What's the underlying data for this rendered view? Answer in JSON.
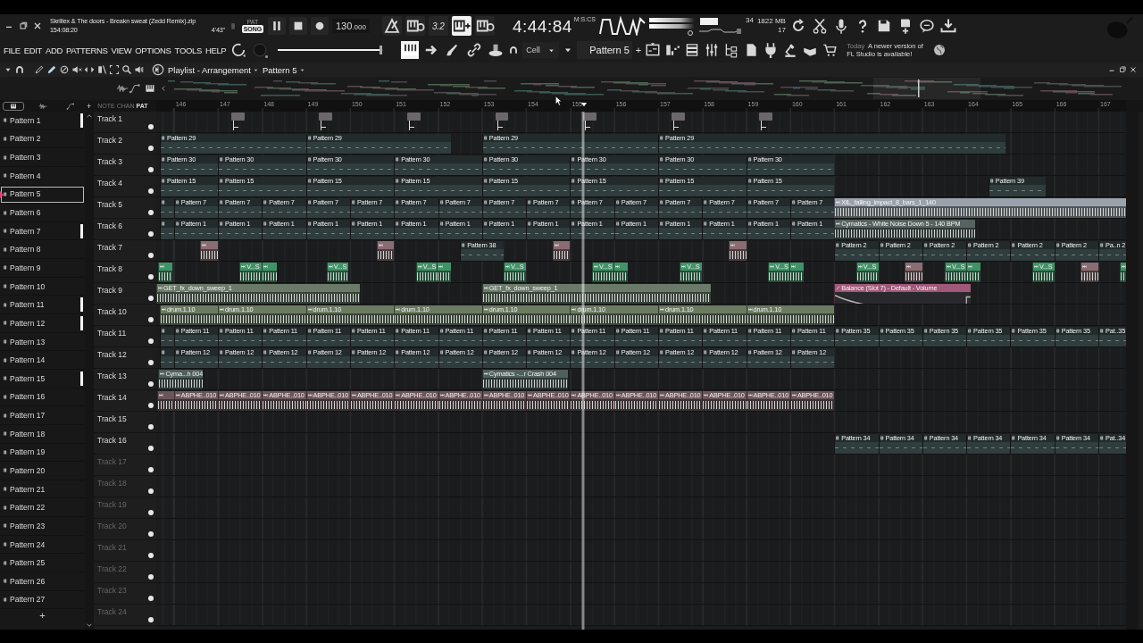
{
  "title_bar": {
    "song": "Skrillex & The doors - Breakn sweat (Zedd Remix).zip",
    "position": "154:08:20",
    "length": "4'43\""
  },
  "transport": {
    "modes": [
      {
        "label": "PAT",
        "selected": false
      },
      {
        "label": "SONG",
        "selected": true
      }
    ],
    "tempo": "130",
    "tempo_fraction": ".000",
    "toggles": [
      {
        "on": false
      },
      {
        "on": false
      },
      {
        "label": "3.2",
        "on": false
      },
      {
        "on": true
      },
      {
        "on": false
      }
    ],
    "time": "4:44:84",
    "time_unit": "M:S:CS"
  },
  "monitor": {
    "cpu": "34",
    "memory": "1822 MB",
    "polyphony": "17"
  },
  "menu": [
    "FILE",
    "EDIT",
    "ADD",
    "PATTERNS",
    "VIEW",
    "OPTIONS",
    "TOOLS",
    "HELP"
  ],
  "master_volume": {
    "level": 0.97
  },
  "toolbar": {
    "snap": "Cell",
    "pattern": "Pattern 5",
    "add": "+",
    "notice_time": "Today",
    "notice": "A newer version of FL Studio is available!"
  },
  "playlist": {
    "title": "Playlist - Arrangement",
    "pattern": "Pattern 5",
    "add": "+",
    "picker_tabs": [
      {
        "label": "NOTE",
        "selected": false
      },
      {
        "label": "CHAN",
        "selected": false
      },
      {
        "label": "PAT",
        "selected": true
      }
    ],
    "ruler": [
      "146",
      "147",
      "148",
      "149",
      "150",
      "151",
      "152",
      "153",
      "154",
      "155",
      "156",
      "157",
      "158",
      "159",
      "160",
      "161",
      "162",
      "163",
      "164",
      "165",
      "166",
      "167"
    ],
    "patterns": [
      {
        "name": "Pattern 1",
        "selected": false,
        "marked": true
      },
      {
        "name": "Pattern 2",
        "selected": false,
        "marked": false
      },
      {
        "name": "Pattern 3",
        "selected": false,
        "marked": false
      },
      {
        "name": "Pattern 4",
        "selected": false,
        "marked": false
      },
      {
        "name": "Pattern 5",
        "selected": true,
        "marked": false
      },
      {
        "name": "Pattern 6",
        "selected": false,
        "marked": false
      },
      {
        "name": "Pattern 7",
        "selected": false,
        "marked": true
      },
      {
        "name": "Pattern 8",
        "selected": false,
        "marked": false
      },
      {
        "name": "Pattern 9",
        "selected": false,
        "marked": false
      },
      {
        "name": "Pattern 10",
        "selected": false,
        "marked": false
      },
      {
        "name": "Pattern 11",
        "selected": false,
        "marked": true
      },
      {
        "name": "Pattern 12",
        "selected": false,
        "marked": true
      },
      {
        "name": "Pattern 13",
        "selected": false,
        "marked": false
      },
      {
        "name": "Pattern 14",
        "selected": false,
        "marked": false
      },
      {
        "name": "Pattern 15",
        "selected": false,
        "marked": true
      },
      {
        "name": "Pattern 16",
        "selected": false,
        "marked": false
      },
      {
        "name": "Pattern 17",
        "selected": false,
        "marked": false
      },
      {
        "name": "Pattern 18",
        "selected": false,
        "marked": false
      },
      {
        "name": "Pattern 19",
        "selected": false,
        "marked": false
      },
      {
        "name": "Pattern 20",
        "selected": false,
        "marked": false
      },
      {
        "name": "Pattern 21",
        "selected": false,
        "marked": false
      },
      {
        "name": "Pattern 22",
        "selected": false,
        "marked": false
      },
      {
        "name": "Pattern 23",
        "selected": false,
        "marked": false
      },
      {
        "name": "Pattern 24",
        "selected": false,
        "marked": false
      },
      {
        "name": "Pattern 25",
        "selected": false,
        "marked": false
      },
      {
        "name": "Pattern 26",
        "selected": false,
        "marked": false
      },
      {
        "name": "Pattern 27",
        "selected": false,
        "marked": false
      }
    ],
    "tracks": [
      {
        "name": "Track 1",
        "dim": false,
        "clips": [
          {
            "kind": "marker",
            "color": "#6c676b"
          },
          {
            "kind": "marker",
            "color": "#6c676b"
          },
          {
            "kind": "marker",
            "color": "#6c676b"
          },
          {
            "kind": "marker",
            "color": "#6c676b"
          },
          {
            "kind": "marker",
            "color": "#6c676b"
          },
          {
            "kind": "marker",
            "color": "#6c676b"
          },
          {
            "kind": "marker",
            "color": "#6c676b"
          }
        ]
      },
      {
        "name": "Track 2",
        "dim": false,
        "clips": [
          {
            "kind": "pattern",
            "label": "Pattern 29"
          },
          {
            "kind": "pattern",
            "label": "Pattern 29"
          },
          {
            "kind": "pattern",
            "label": "Pattern 29"
          },
          {
            "kind": "pattern",
            "label": "Pattern 29"
          }
        ]
      },
      {
        "name": "Track 3",
        "dim": false,
        "clips": [
          {
            "kind": "pattern",
            "label": "Pattern 30"
          },
          {
            "kind": "pattern",
            "label": "Pattern 30"
          },
          {
            "kind": "pattern",
            "label": "Pattern 30"
          },
          {
            "kind": "pattern",
            "label": "Pattern 30"
          },
          {
            "kind": "pattern",
            "label": "Pattern 30"
          },
          {
            "kind": "pattern",
            "label": "Pattern 30"
          },
          {
            "kind": "pattern",
            "label": "Pattern 30"
          },
          {
            "kind": "pattern",
            "label": "Pattern 30"
          }
        ]
      },
      {
        "name": "Track 4",
        "dim": false,
        "clips": [
          {
            "kind": "pattern",
            "label": "Pattern 15"
          },
          {
            "kind": "pattern",
            "label": "Pattern 15"
          },
          {
            "kind": "pattern",
            "label": "Pattern 15"
          },
          {
            "kind": "pattern",
            "label": "Pattern 15"
          },
          {
            "kind": "pattern",
            "label": "Pattern 15"
          },
          {
            "kind": "pattern",
            "label": "Pattern 15"
          },
          {
            "kind": "pattern",
            "label": "Pattern 15"
          },
          {
            "kind": "pattern",
            "label": "Pattern 15"
          },
          {
            "kind": "pattern",
            "label": "Pattern 39"
          }
        ]
      },
      {
        "name": "Track 5",
        "dim": false,
        "clips": [
          {
            "kind": "pattern"
          },
          {
            "kind": "pattern",
            "label": "Pattern 7"
          },
          {
            "kind": "pattern",
            "label": "Pattern 7"
          },
          {
            "kind": "pattern",
            "label": "Pattern 7"
          },
          {
            "kind": "pattern",
            "label": "Pattern 7"
          },
          {
            "kind": "pattern",
            "label": "Pattern 7"
          },
          {
            "kind": "pattern",
            "label": "Pattern 7"
          },
          {
            "kind": "pattern",
            "label": "Pattern 7"
          },
          {
            "kind": "pattern",
            "label": "Pattern 7"
          },
          {
            "kind": "pattern",
            "label": "Pattern 7"
          },
          {
            "kind": "pattern",
            "label": "Pattern 7"
          },
          {
            "kind": "pattern",
            "label": "Pattern 7"
          },
          {
            "kind": "pattern",
            "label": "Pattern 7"
          },
          {
            "kind": "pattern",
            "label": "Pattern 7"
          },
          {
            "kind": "pattern",
            "label": "Pattern 7"
          },
          {
            "kind": "pattern",
            "label": "Pattern 7"
          },
          {
            "kind": "audio",
            "label": "XIL_falling_impact_8_bars_1_140",
            "color": "#9aa3ab"
          }
        ]
      },
      {
        "name": "Track 6",
        "dim": false,
        "clips": [
          {
            "kind": "pattern"
          },
          {
            "kind": "pattern",
            "label": "Pattern 1"
          },
          {
            "kind": "pattern",
            "label": "Pattern 1"
          },
          {
            "kind": "pattern",
            "label": "Pattern 1"
          },
          {
            "kind": "pattern",
            "label": "Pattern 1"
          },
          {
            "kind": "pattern",
            "label": "Pattern 1"
          },
          {
            "kind": "pattern",
            "label": "Pattern 1"
          },
          {
            "kind": "pattern",
            "label": "Pattern 1"
          },
          {
            "kind": "pattern",
            "label": "Pattern 1"
          },
          {
            "kind": "pattern",
            "label": "Pattern 1"
          },
          {
            "kind": "pattern",
            "label": "Pattern 1"
          },
          {
            "kind": "pattern",
            "label": "Pattern 1"
          },
          {
            "kind": "pattern",
            "label": "Pattern 1"
          },
          {
            "kind": "pattern",
            "label": "Pattern 1"
          },
          {
            "kind": "pattern",
            "label": "Pattern 1"
          },
          {
            "kind": "pattern",
            "label": "Pattern 1"
          },
          {
            "kind": "audio",
            "label": "Cymatics - White Noise Down 5 - 140 BPM",
            "color": "#56635f"
          }
        ]
      },
      {
        "name": "Track 7",
        "dim": false,
        "clips": [
          {
            "kind": "audio",
            "color": "#8a6c72"
          },
          {
            "kind": "audio",
            "color": "#8a6c72"
          },
          {
            "kind": "pattern",
            "label": "Pattern 38"
          },
          {
            "kind": "audio",
            "color": "#8a6c72"
          },
          {
            "kind": "audio",
            "color": "#8a6c72"
          },
          {
            "kind": "pattern",
            "label": "Pattern 2"
          },
          {
            "kind": "pattern",
            "label": "Pattern 2"
          },
          {
            "kind": "pattern",
            "label": "Pattern 2"
          },
          {
            "kind": "pattern",
            "label": "Pattern 2"
          },
          {
            "kind": "pattern",
            "label": "Pattern 2"
          },
          {
            "kind": "pattern",
            "label": "Pattern 2"
          },
          {
            "kind": "pattern",
            "label": "Pa..n 2"
          }
        ]
      },
      {
        "name": "Track 8",
        "dim": false,
        "clips": [
          {
            "kind": "audio",
            "color": "#3f9466"
          },
          {
            "kind": "audio",
            "label": "V...S",
            "color": "#3f9466"
          },
          {
            "kind": "audio",
            "color": "#3f9466"
          },
          {
            "kind": "audio",
            "label": "V...S",
            "color": "#3f9466"
          },
          {
            "kind": "audio",
            "label": "V...S",
            "color": "#3f9466"
          },
          {
            "kind": "audio",
            "color": "#3f9466"
          },
          {
            "kind": "audio",
            "label": "V...S",
            "color": "#3f9466"
          },
          {
            "kind": "audio",
            "label": "V...S",
            "color": "#3f9466"
          },
          {
            "kind": "audio",
            "color": "#3f9466"
          },
          {
            "kind": "audio",
            "label": "V...S",
            "color": "#3f9466"
          },
          {
            "kind": "audio",
            "label": "V...S",
            "color": "#3f9466"
          },
          {
            "kind": "audio",
            "color": "#3f9466"
          },
          {
            "kind": "audio",
            "label": "V...S",
            "color": "#3f9466"
          },
          {
            "kind": "audio",
            "color": "#8a6c72"
          },
          {
            "kind": "audio",
            "label": "V...S",
            "color": "#3f9466"
          },
          {
            "kind": "audio",
            "color": "#3f9466"
          },
          {
            "kind": "audio",
            "label": "V...S",
            "color": "#3f9466"
          },
          {
            "kind": "audio",
            "color": "#8a6c72"
          },
          {
            "kind": "audio",
            "color": "#3f9466"
          }
        ]
      },
      {
        "name": "Track 9",
        "dim": false,
        "clips": [
          {
            "kind": "audio",
            "label": "GET_fx_down_sweep_1",
            "color": "#6a7a69"
          },
          {
            "kind": "audio",
            "label": "GET_fx_down_sweep_1",
            "color": "#6a7a69"
          },
          {
            "kind": "automation",
            "label": "Balance (Slot 7) - Default - Volume",
            "color": "#a0587a"
          }
        ]
      },
      {
        "name": "Track 10",
        "dim": false,
        "clips": [
          {
            "kind": "audio",
            "label": "drum.1.10",
            "color": "#6b7b62"
          },
          {
            "kind": "audio",
            "label": "drum.1.10",
            "color": "#6b7b62"
          },
          {
            "kind": "audio",
            "label": "drum.1.10",
            "color": "#6b7b62"
          },
          {
            "kind": "audio",
            "label": "drum.1.10",
            "color": "#6b7b62"
          },
          {
            "kind": "audio",
            "label": "drum.1.10",
            "color": "#6b7b62"
          },
          {
            "kind": "audio",
            "label": "drum.1.10",
            "color": "#6b7b62"
          },
          {
            "kind": "audio",
            "label": "drum.1.10",
            "color": "#6b7b62"
          },
          {
            "kind": "audio",
            "label": "drum.1.10",
            "color": "#6b7b62"
          }
        ]
      },
      {
        "name": "Track 11",
        "dim": false,
        "clips": [
          {
            "kind": "pattern"
          },
          {
            "kind": "pattern",
            "label": "Pattern 11"
          },
          {
            "kind": "pattern",
            "label": "Pattern 11"
          },
          {
            "kind": "pattern",
            "label": "Pattern 11"
          },
          {
            "kind": "pattern",
            "label": "Pattern 11"
          },
          {
            "kind": "pattern",
            "label": "Pattern 11"
          },
          {
            "kind": "pattern",
            "label": "Pattern 11"
          },
          {
            "kind": "pattern",
            "label": "Pattern 11"
          },
          {
            "kind": "pattern",
            "label": "Pattern 11"
          },
          {
            "kind": "pattern",
            "label": "Pattern 11"
          },
          {
            "kind": "pattern",
            "label": "Pattern 11"
          },
          {
            "kind": "pattern",
            "label": "Pattern 11"
          },
          {
            "kind": "pattern",
            "label": "Pattern 11"
          },
          {
            "kind": "pattern",
            "label": "Pattern 11"
          },
          {
            "kind": "pattern",
            "label": "Pattern 11"
          },
          {
            "kind": "pattern",
            "label": "Pattern 11"
          },
          {
            "kind": "pattern",
            "label": "Pattern 35"
          },
          {
            "kind": "pattern",
            "label": "Pattern 35"
          },
          {
            "kind": "pattern",
            "label": "Pattern 35"
          },
          {
            "kind": "pattern",
            "label": "Pattern 35"
          },
          {
            "kind": "pattern",
            "label": "Pattern 35"
          },
          {
            "kind": "pattern",
            "label": "Pattern 35"
          },
          {
            "kind": "pattern",
            "label": "Pat..35"
          }
        ]
      },
      {
        "name": "Track 12",
        "dim": false,
        "clips": [
          {
            "kind": "pattern"
          },
          {
            "kind": "pattern",
            "label": "Pattern 12"
          },
          {
            "kind": "pattern",
            "label": "Pattern 12"
          },
          {
            "kind": "pattern",
            "label": "Pattern 12"
          },
          {
            "kind": "pattern",
            "label": "Pattern 12"
          },
          {
            "kind": "pattern",
            "label": "Pattern 12"
          },
          {
            "kind": "pattern",
            "label": "Pattern 12"
          },
          {
            "kind": "pattern",
            "label": "Pattern 12"
          },
          {
            "kind": "pattern",
            "label": "Pattern 12"
          },
          {
            "kind": "pattern",
            "label": "Pattern 12"
          },
          {
            "kind": "pattern",
            "label": "Pattern 12"
          },
          {
            "kind": "pattern",
            "label": "Pattern 12"
          },
          {
            "kind": "pattern",
            "label": "Pattern 12"
          },
          {
            "kind": "pattern",
            "label": "Pattern 12"
          },
          {
            "kind": "pattern",
            "label": "Pattern 12"
          },
          {
            "kind": "pattern",
            "label": "Pattern 12"
          }
        ]
      },
      {
        "name": "Track 13",
        "dim": false,
        "clips": [
          {
            "kind": "audio",
            "label": "Cyma...h 004",
            "color": "#4f5f5c"
          },
          {
            "kind": "audio",
            "label": "Cymatics -...r Crash 004",
            "color": "#4f5f5c"
          }
        ]
      },
      {
        "name": "Track 14",
        "dim": false,
        "clips": [
          {
            "kind": "audio",
            "color": "#6a555a"
          },
          {
            "kind": "audio",
            "label": "ABPHE..010",
            "color": "#6a555a"
          },
          {
            "kind": "audio",
            "label": "ABPHE..010",
            "color": "#6a555a"
          },
          {
            "kind": "audio",
            "label": "ABPHE..010",
            "color": "#6a555a"
          },
          {
            "kind": "audio",
            "label": "ABPHE..010",
            "color": "#6a555a"
          },
          {
            "kind": "audio",
            "label": "ABPHE..010",
            "color": "#6a555a"
          },
          {
            "kind": "audio",
            "label": "ABPHE..010",
            "color": "#6a555a"
          },
          {
            "kind": "audio",
            "label": "ABPHE..010",
            "color": "#6a555a"
          },
          {
            "kind": "audio",
            "label": "ABPHE..010",
            "color": "#6a555a"
          },
          {
            "kind": "audio",
            "label": "ABPHE..010",
            "color": "#6a555a"
          },
          {
            "kind": "audio",
            "label": "ABPHE..010",
            "color": "#6a555a"
          },
          {
            "kind": "audio",
            "label": "ABPHE..010",
            "color": "#6a555a"
          },
          {
            "kind": "audio",
            "label": "ABPHE..010",
            "color": "#6a555a"
          },
          {
            "kind": "audio",
            "label": "ABPHE..010",
            "color": "#6a555a"
          },
          {
            "kind": "audio",
            "label": "ABPHE..010",
            "color": "#6a555a"
          },
          {
            "kind": "audio",
            "label": "ABPHE..010",
            "color": "#6a555a"
          }
        ]
      },
      {
        "name": "Track 15",
        "dim": false
      },
      {
        "name": "Track 16",
        "dim": false,
        "clips": [
          {
            "kind": "pattern",
            "label": "Pattern 34"
          },
          {
            "kind": "pattern",
            "label": "Pattern 34"
          },
          {
            "kind": "pattern",
            "label": "Pattern 34"
          },
          {
            "kind": "pattern",
            "label": "Pattern 34"
          },
          {
            "kind": "pattern",
            "label": "Pattern 34"
          },
          {
            "kind": "pattern",
            "label": "Pattern 34"
          },
          {
            "kind": "pattern",
            "label": "Pat..34"
          }
        ]
      },
      {
        "name": "Track 17",
        "dim": true
      },
      {
        "name": "Track 18",
        "dim": true
      },
      {
        "name": "Track 19",
        "dim": true
      },
      {
        "name": "Track 20",
        "dim": true
      },
      {
        "name": "Track 21",
        "dim": true
      },
      {
        "name": "Track 22",
        "dim": true
      },
      {
        "name": "Track 23",
        "dim": true
      },
      {
        "name": "Track 24",
        "dim": true
      }
    ]
  }
}
